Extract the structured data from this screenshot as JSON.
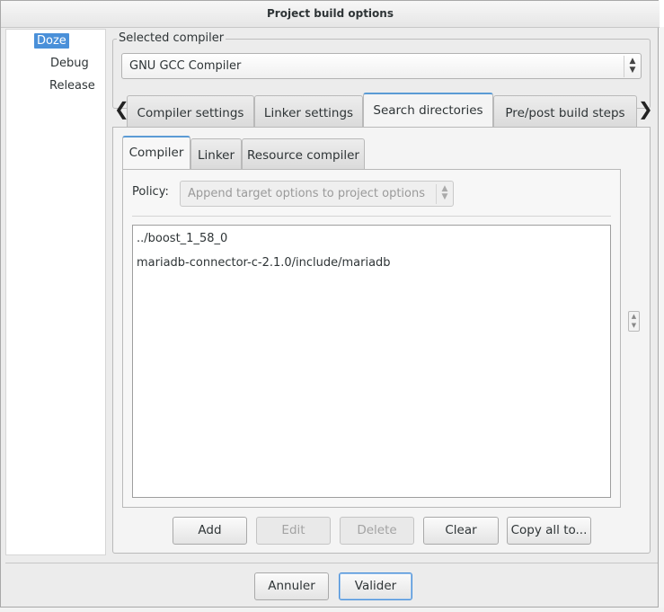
{
  "window": {
    "title": "Project build options"
  },
  "tree": {
    "items": [
      "Doze",
      "Debug",
      "Release"
    ]
  },
  "compiler": {
    "label": "Selected compiler",
    "value": "GNU GCC Compiler"
  },
  "tabs": [
    "Compiler settings",
    "Linker settings",
    "Search directories",
    "Pre/post build steps"
  ],
  "subtabs": [
    "Compiler",
    "Linker",
    "Resource compiler"
  ],
  "policy": {
    "label": "Policy:",
    "value": "Append target options to project options"
  },
  "directories": [
    "../boost_1_58_0",
    "mariadb-connector-c-2.1.0/include/mariadb"
  ],
  "buttons": {
    "add": "Add",
    "edit": "Edit",
    "delete": "Delete",
    "clear": "Clear",
    "copy": "Copy all to..."
  },
  "footer": {
    "cancel": "Annuler",
    "ok": "Valider"
  },
  "icons": {
    "tab_left": "chevron-left-icon",
    "tab_right": "chevron-right-icon"
  }
}
